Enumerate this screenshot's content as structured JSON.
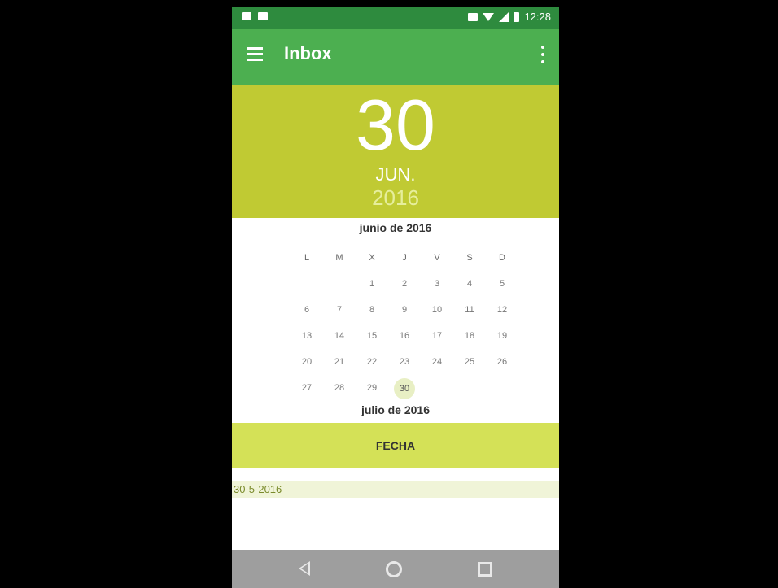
{
  "status_bar": {
    "time": "12:28"
  },
  "app_bar": {
    "title": "Inbox"
  },
  "date_header": {
    "day": "30",
    "month": "JUN.",
    "year": "2016"
  },
  "calendar": {
    "current_month_label": "junio de 2016",
    "next_month_label": "julio de 2016",
    "weekdays": [
      "L",
      "M",
      "X",
      "J",
      "V",
      "S",
      "D"
    ],
    "weeks": [
      [
        "",
        "",
        "1",
        "2",
        "3",
        "4",
        "5"
      ],
      [
        "6",
        "7",
        "8",
        "9",
        "10",
        "11",
        "12"
      ],
      [
        "13",
        "14",
        "15",
        "16",
        "17",
        "18",
        "19"
      ],
      [
        "20",
        "21",
        "22",
        "23",
        "24",
        "25",
        "26"
      ],
      [
        "27",
        "28",
        "29",
        "30",
        "",
        "",
        ""
      ]
    ],
    "selected_day": "30"
  },
  "fecha_button": {
    "label": "FECHA"
  },
  "date_field": {
    "value": "30-5-2016"
  }
}
